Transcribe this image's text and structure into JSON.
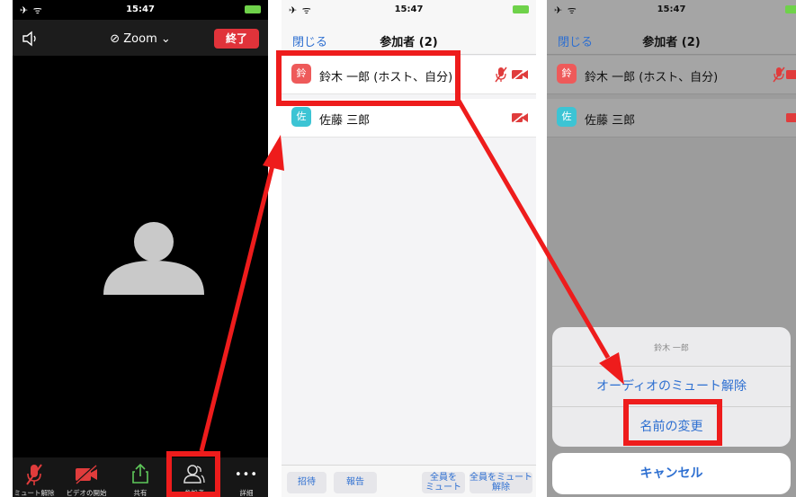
{
  "status": {
    "left_icons": "✈ ᯤ",
    "time": "15:47"
  },
  "meeting": {
    "title": "⊘ Zoom ⌄",
    "end_label": "終了",
    "toolbar": [
      {
        "label": "ミュート解除",
        "icon": "mic-muted-icon"
      },
      {
        "label": "ビデオの開始",
        "icon": "video-off-icon"
      },
      {
        "label": "共有",
        "icon": "share-icon"
      },
      {
        "label": "参加者",
        "icon": "participants-icon"
      },
      {
        "label": "詳細",
        "icon": "more-icon"
      }
    ],
    "more_glyph": "•••"
  },
  "participants": {
    "close_label": "閉じる",
    "title": "参加者 (2)",
    "list": [
      {
        "initial": "鈴",
        "name": "鈴木 一郎 (ホスト、自分)",
        "avatar_color": "#ee5a5a"
      },
      {
        "initial": "佐",
        "name": "佐藤 三郎",
        "avatar_color": "#3cc4d4"
      }
    ],
    "bottom": {
      "invite": "招待",
      "report": "報告",
      "mute_all_l1": "全員を",
      "mute_all_l2": "ミュート",
      "unmute_all_l1": "全員をミュート",
      "unmute_all_l2": "解除"
    }
  },
  "action_sheet": {
    "title": "鈴木 一郎",
    "unmute_audio": "オーディオのミュート解除",
    "rename": "名前の変更",
    "cancel": "キャンセル"
  },
  "colors": {
    "highlight": "#ee1c1c",
    "link_blue": "#2d6fd1",
    "end_red": "#e0333a"
  }
}
